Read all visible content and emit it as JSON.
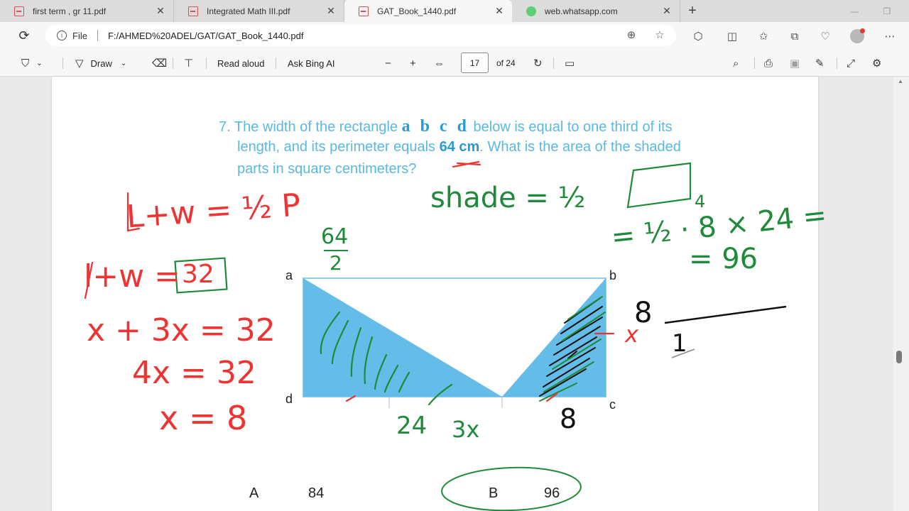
{
  "tabs": [
    {
      "title": "first term , gr 11.pdf",
      "icon": "pdf-icon"
    },
    {
      "title": "Integrated Math III.pdf",
      "icon": "pdf-icon"
    },
    {
      "title": "GAT_Book_1440.pdf",
      "icon": "pdf-icon",
      "active": true
    },
    {
      "title": "web.whatsapp.com",
      "icon": "whatsapp-icon"
    }
  ],
  "address": {
    "scheme_label": "File",
    "url": "F:/AHMED%20ADEL/GAT/GAT_Book_1440.pdf"
  },
  "pdf_toolbar": {
    "draw_label": "Draw",
    "read_aloud_label": "Read aloud",
    "ask_bing_label": "Ask Bing AI",
    "page_number": "17",
    "page_total": "of 24"
  },
  "question": {
    "number": "7.",
    "line1_pre": "The width of the rectangle",
    "line1_letters": "a b c d",
    "line1_post": "below is equal to one third of its",
    "line2_pre": "length, and its perimeter equals",
    "line2_value": "64 cm",
    "line2_post": ". What is the area of the shaded",
    "line3": "parts in square centimeters?"
  },
  "diagram": {
    "a": "a",
    "b": "b",
    "c": "c",
    "d": "d",
    "fill_color": "#63bde8"
  },
  "answers": [
    {
      "letter": "A",
      "value": "84"
    },
    {
      "letter": "B",
      "value": "96"
    }
  ],
  "handwriting": {
    "red": {
      "l1": "L+w = ½ P",
      "l2": "l+w =",
      "l2box": "32",
      "l3": "x + 3x = 32",
      "l4": "4x = 32",
      "l5": "x = 8",
      "side_x": "x"
    },
    "green": {
      "half_top": "64",
      "half_bot": "2",
      "shade": "shade = ½",
      "four": "4",
      "calc1": "= ½ · 8 × 24 =",
      "calc2": "= 96",
      "bottom24": "24",
      "bottom3x": "3x"
    },
    "black": {
      "eight_side": "8",
      "eight_bottom": "8",
      "one": "1"
    }
  }
}
